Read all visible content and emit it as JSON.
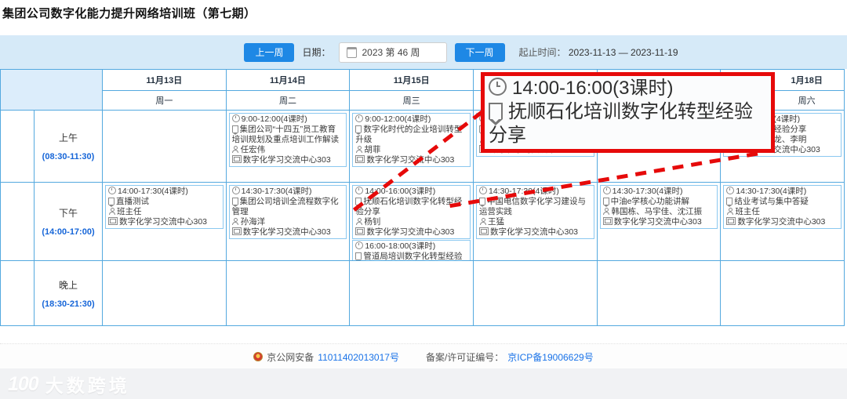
{
  "page_title": "集团公司数字化能力提升网络培训班（第七期）",
  "toolbar": {
    "prev_week": "上一周",
    "date_label": "日期：",
    "date_value": "2023 第 46 周",
    "next_week": "下一周",
    "range_label": "起止时间：",
    "range_value": "2023-11-13 — 2023-11-19"
  },
  "schedule": {
    "days": [
      {
        "date": "11月13日",
        "weekday": "周一"
      },
      {
        "date": "11月14日",
        "weekday": "周二"
      },
      {
        "date": "11月15日",
        "weekday": "周三"
      },
      {
        "date": "",
        "weekday": ""
      },
      {
        "date": "",
        "weekday": ""
      },
      {
        "date": "1月18日",
        "weekday": "周六"
      }
    ],
    "rows": [
      {
        "label": "上午",
        "time": "(08:30-11:30)"
      },
      {
        "label": "下午",
        "time": "(14:00-17:00)"
      },
      {
        "label": "晚上",
        "time": "(18:30-21:30)"
      }
    ],
    "cells": {
      "tue_am": {
        "time": "9:00-12:00(4课时)",
        "title": "集团公司“十四五”员工教育培训规划及重点培训工作解读",
        "speaker": "任宏伟",
        "location": "数字化学习交流中心303"
      },
      "wed_am": {
        "time": "9:00-12:00(4课时)",
        "title": "数字化时代的企业培训转型升级",
        "speaker": "胡菲",
        "location": "数字化学习交流中心303"
      },
      "thu_am": {
        "location": "数字化学习交流中心303"
      },
      "sat_am": {
        "time_fragment": "(4课时)",
        "title_fragment": "经验分享",
        "speaker_fragment": "龙、李明",
        "location_fragment": "交流中心303"
      },
      "mon_pm": {
        "time": "14:00-17:30(4课时)",
        "title": "直播测试",
        "speaker": "班主任",
        "location": "数字化学习交流中心303"
      },
      "tue_pm": {
        "time": "14:30-17:30(4课时)",
        "title": "集团公司培训全流程数字化管理",
        "speaker": "孙海洋",
        "location": "数字化学习交流中心303"
      },
      "wed_pm1": {
        "time": "14:00-16:00(3课时)",
        "title": "抚顺石化培训数字化转型经验分享",
        "speaker": "杨钊",
        "location": "数字化学习交流中心303"
      },
      "wed_pm2": {
        "time": "16:00-18:00(3课时)",
        "title": "管道局培训数字化转型经验分享"
      },
      "thu_pm": {
        "time": "14:30-17:30(4课时)",
        "title": "中国电信数字化学习建设与运营实践",
        "speaker": "王猛",
        "location": "数字化学习交流中心303"
      },
      "fri_pm": {
        "time": "14:30-17:30(4课时)",
        "title": "中油e学核心功能讲解",
        "speaker": "韩国栋、马宇佳、沈江振",
        "location": "数字化学习交流中心303"
      },
      "sat_pm": {
        "time": "14:30-17:30(4课时)",
        "title": "结业考试与集中答疑",
        "speaker": "班主任",
        "location": "数字化学习交流中心303"
      }
    }
  },
  "callout": {
    "time": "14:00-16:00(3课时)",
    "title": "抚顺石化培训数字化转型经验分享",
    "border_color": "#E60A0A"
  },
  "footer": {
    "police_label": "京公网安备",
    "police_number": "11011402013017号",
    "icp_label": "备案/许可证编号：",
    "icp_number": "京ICP备19006629号"
  },
  "watermark": {
    "logo": "100",
    "text": "大数跨境"
  },
  "colors": {
    "accent_blue": "#1E88E5",
    "toolbar_bg": "#D6EAF8",
    "grid_border": "#54A9DF",
    "card_border": "#8BC8F0",
    "time_blue": "#1565D8",
    "callout_red": "#E60A0A",
    "link_blue": "#1A73E8"
  },
  "icons": {
    "clock": "clock-icon",
    "bookmark": "bookmark-icon",
    "speaker": "person-icon",
    "location": "room-icon",
    "calendar": "calendar-icon",
    "police": "police-badge-icon"
  }
}
